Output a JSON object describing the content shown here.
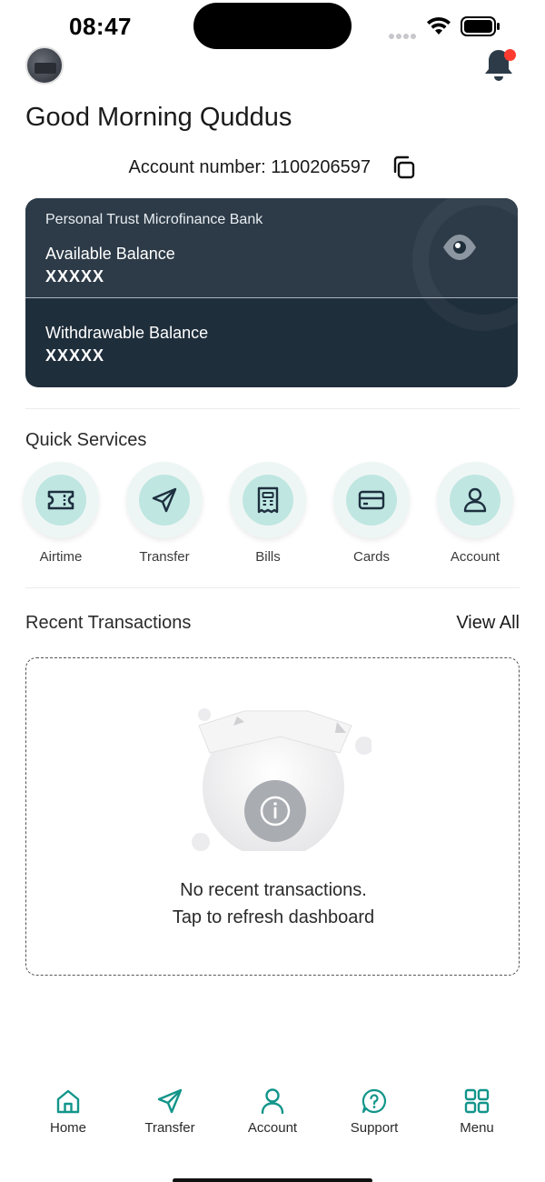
{
  "status_bar": {
    "time": "08:47"
  },
  "header": {
    "greeting": "Good Morning Quddus",
    "account_number_text": "Account number: 1100206597"
  },
  "balance_card": {
    "bank_name": "Personal Trust Microfinance Bank",
    "available_label": "Available Balance",
    "available_value": "XXXXX",
    "withdrawable_label": "Withdrawable Balance",
    "withdrawable_value": "XXXXX"
  },
  "quick_services": {
    "title": "Quick Services",
    "items": [
      {
        "label": "Airtime",
        "icon": "ticket-icon"
      },
      {
        "label": "Transfer",
        "icon": "send-icon"
      },
      {
        "label": "Bills",
        "icon": "receipt-icon"
      },
      {
        "label": "Cards",
        "icon": "card-icon"
      },
      {
        "label": "Account",
        "icon": "user-icon"
      }
    ]
  },
  "recent_transactions": {
    "title": "Recent Transactions",
    "view_all": "View All",
    "empty_line1": "No recent transactions.",
    "empty_line2": "Tap to refresh dashboard"
  },
  "bottom_nav": {
    "items": [
      {
        "label": "Home",
        "icon": "home-icon"
      },
      {
        "label": "Transfer",
        "icon": "send-icon"
      },
      {
        "label": "Account",
        "icon": "user-icon"
      },
      {
        "label": "Support",
        "icon": "help-chat-icon"
      },
      {
        "label": "Menu",
        "icon": "grid-icon"
      }
    ]
  },
  "colors": {
    "accent": "#12958a",
    "card_dark": "#1f2e3b",
    "card_top": "#2d3b48",
    "service_bg": "#bfe6e1",
    "notification_dot": "#ff3b30"
  }
}
